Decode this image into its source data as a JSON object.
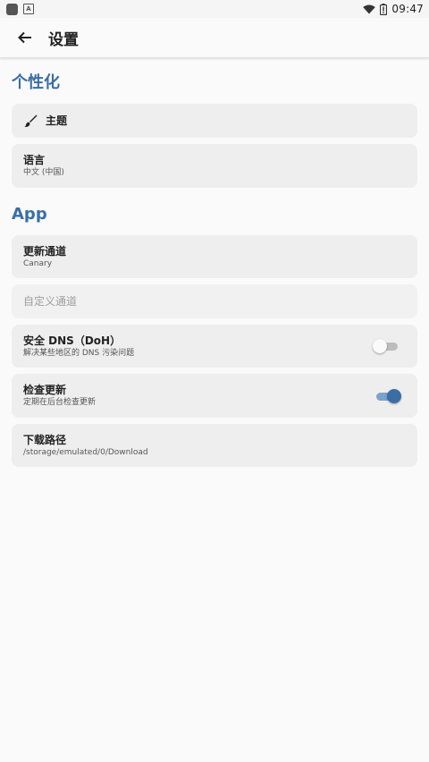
{
  "status_bar": {
    "time": "09:47"
  },
  "header": {
    "title": "设置"
  },
  "sections": [
    {
      "title": "个性化"
    },
    {
      "title": "App"
    }
  ],
  "settings": {
    "theme": {
      "title": "主题"
    },
    "language": {
      "title": "语言",
      "subtitle": "中文 (中国)"
    },
    "update_channel": {
      "title": "更新通道",
      "subtitle": "Canary"
    },
    "custom_channel": {
      "title": "自定义通道"
    },
    "secure_dns": {
      "title": "安全 DNS（DoH）",
      "subtitle": "解决某些地区的 DNS 污染问题",
      "enabled": false
    },
    "check_updates": {
      "title": "检查更新",
      "subtitle": "定期在后台检查更新",
      "enabled": true
    },
    "download_path": {
      "title": "下载路径",
      "subtitle": "/storage/emulated/0/Download"
    }
  },
  "colors": {
    "accent": "#3a6ea5",
    "card_bg": "#eeeeee",
    "background": "#fafafa"
  },
  "icons": {
    "back": "arrow-left-icon",
    "theme": "brush-icon",
    "wifi": "wifi-icon",
    "battery": "battery-icon"
  }
}
